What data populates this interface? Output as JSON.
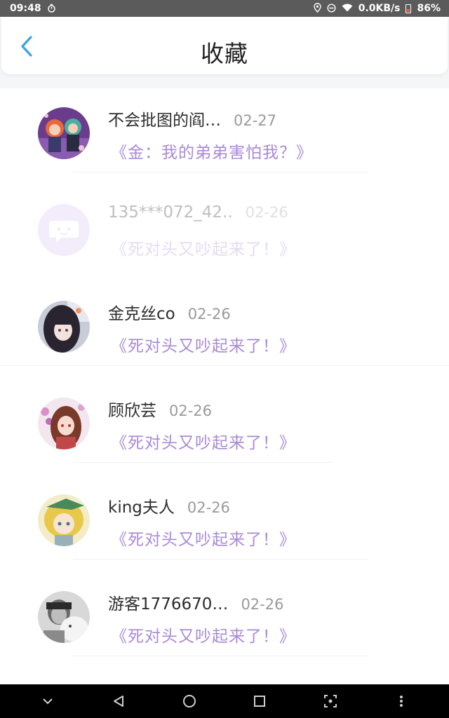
{
  "status_bar": {
    "time": "09:48",
    "network_speed": "0.0KB/s",
    "battery": "86%"
  },
  "header": {
    "title": "收藏"
  },
  "items": [
    {
      "name": "不会批图的阎…",
      "date": "02-27",
      "book": "《金：我的弟弟害怕我？》",
      "avatar": "avatar-anime-duo"
    },
    {
      "name": "135***072_42..",
      "date": "02-26",
      "book": "《死对头又吵起来了！》",
      "avatar": "avatar-default-chat"
    },
    {
      "name": "金克丝co",
      "date": "02-26",
      "book": "《死对头又吵起来了！》",
      "avatar": "avatar-anime-girl-dark"
    },
    {
      "name": "顾欣芸",
      "date": "02-26",
      "book": "《死对头又吵起来了！》",
      "avatar": "avatar-anime-girl-red"
    },
    {
      "name": "king夫人",
      "date": "02-26",
      "book": "《死对头又吵起来了！》",
      "avatar": "avatar-anime-boy-blond"
    },
    {
      "name": "游客1776670…",
      "date": "02-26",
      "book": "《死对头又吵起来了！》",
      "avatar": "avatar-photo-bw"
    }
  ],
  "colors": {
    "accent": "#3aa0e6",
    "book_title": "#a98ad6",
    "status_bar": "#5b5b5b"
  }
}
